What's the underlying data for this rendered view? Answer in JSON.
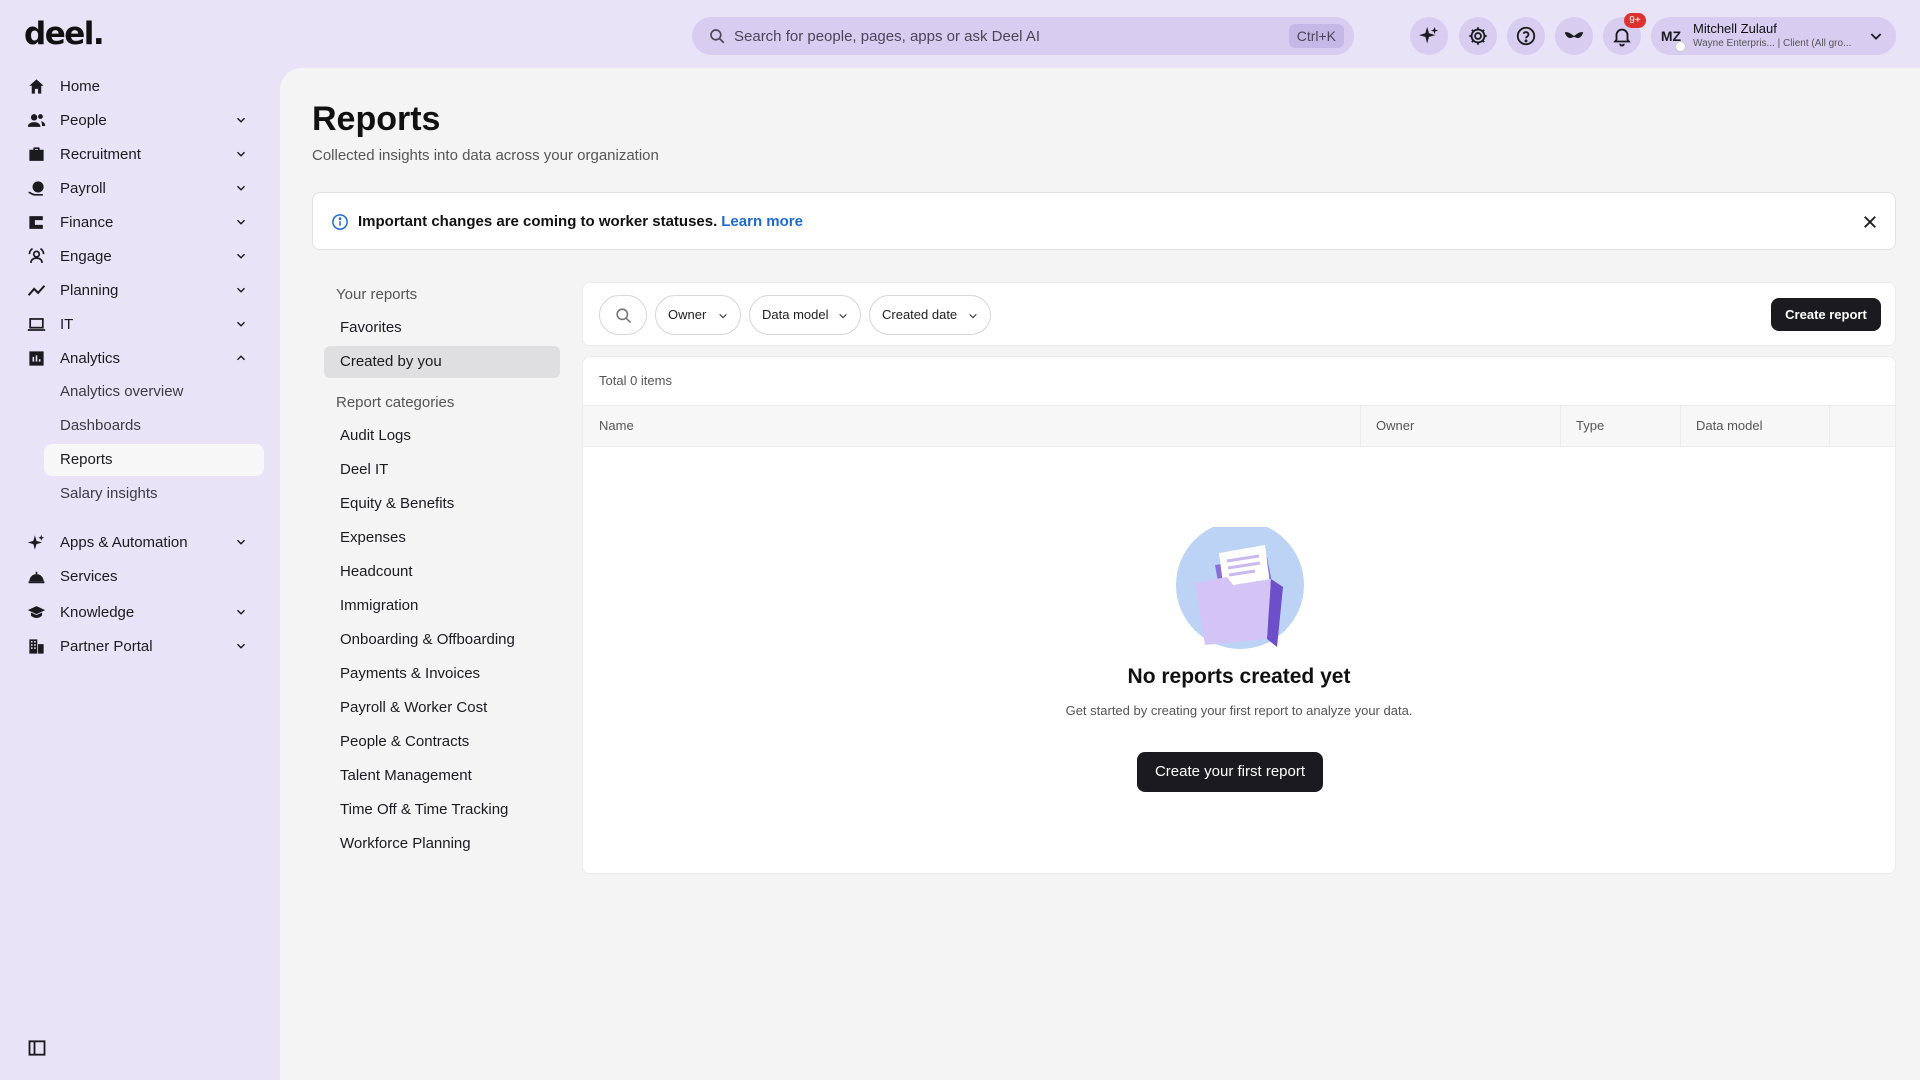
{
  "app": {
    "logo": "deel.",
    "search_placeholder": "Search for people, pages, apps or ask Deel AI",
    "search_shortcut": "Ctrl+K",
    "notification_count": "9+",
    "user": {
      "initials": "MZ",
      "name": "Mitchell Zulauf",
      "subtitle": "Wayne Enterpris... | Client (All gro..."
    }
  },
  "sidebar": {
    "items": [
      {
        "label": "Home",
        "icon": "home-icon",
        "expandable": false
      },
      {
        "label": "People",
        "icon": "people-icon",
        "expandable": true
      },
      {
        "label": "Recruitment",
        "icon": "briefcase-icon",
        "expandable": true
      },
      {
        "label": "Payroll",
        "icon": "payroll-icon",
        "expandable": true
      },
      {
        "label": "Finance",
        "icon": "wallet-icon",
        "expandable": true
      },
      {
        "label": "Engage",
        "icon": "engage-icon",
        "expandable": true
      },
      {
        "label": "Planning",
        "icon": "trend-icon",
        "expandable": true
      },
      {
        "label": "IT",
        "icon": "laptop-icon",
        "expandable": true
      },
      {
        "label": "Analytics",
        "icon": "chart-icon",
        "expandable": true,
        "expanded": true
      },
      {
        "label": "Apps & Automation",
        "icon": "sparkle-icon",
        "expandable": true
      },
      {
        "label": "Services",
        "icon": "service-bell-icon",
        "expandable": false
      },
      {
        "label": "Knowledge",
        "icon": "graduation-cap-icon",
        "expandable": true
      },
      {
        "label": "Partner Portal",
        "icon": "building-icon",
        "expandable": true
      }
    ],
    "analytics_subitems": [
      {
        "label": "Analytics overview"
      },
      {
        "label": "Dashboards"
      },
      {
        "label": "Reports",
        "active": true
      },
      {
        "label": "Salary insights"
      }
    ]
  },
  "page": {
    "title": "Reports",
    "subtitle": "Collected insights into data across your organization",
    "banner": {
      "text": "Important changes are coming to worker statuses.",
      "link": "Learn more"
    },
    "left_nav": {
      "your_reports_heading": "Your reports",
      "your_reports": [
        {
          "label": "Favorites"
        },
        {
          "label": "Created by you",
          "active": true
        }
      ],
      "categories_heading": "Report categories",
      "categories": [
        {
          "label": "Audit Logs"
        },
        {
          "label": "Deel IT"
        },
        {
          "label": "Equity & Benefits"
        },
        {
          "label": "Expenses"
        },
        {
          "label": "Headcount"
        },
        {
          "label": "Immigration"
        },
        {
          "label": "Onboarding & Offboarding"
        },
        {
          "label": "Payments & Invoices"
        },
        {
          "label": "Payroll & Worker Cost"
        },
        {
          "label": "People & Contracts"
        },
        {
          "label": "Talent Management"
        },
        {
          "label": "Time Off & Time Tracking"
        },
        {
          "label": "Workforce Planning"
        }
      ]
    },
    "filters": {
      "owner": "Owner",
      "data_model": "Data model",
      "created_date": "Created date",
      "create_button": "Create report"
    },
    "table": {
      "total": "Total 0 items",
      "columns": [
        "Name",
        "Owner",
        "Type",
        "Data model"
      ],
      "rows": []
    },
    "empty_state": {
      "title": "No reports created yet",
      "subtitle": "Get started by creating your first report to analyze your data.",
      "button": "Create your first report"
    }
  }
}
